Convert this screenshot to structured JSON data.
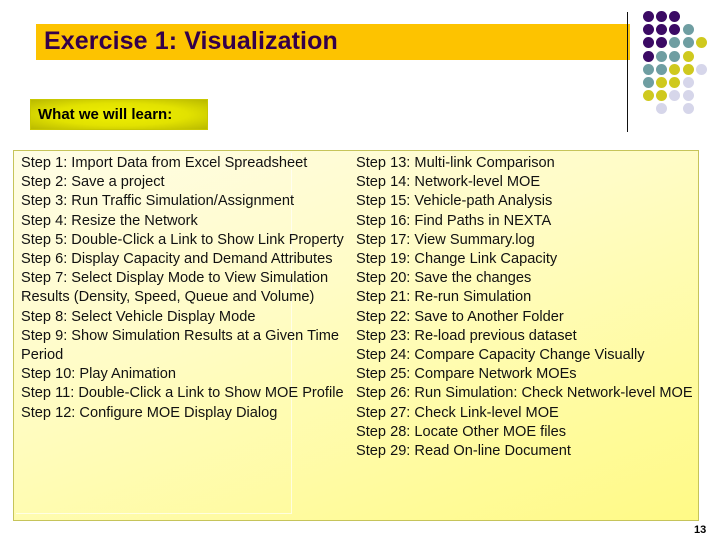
{
  "slide": {
    "title": "Exercise 1: Visualization",
    "subtitle": "What we will learn:",
    "page_number": "13",
    "colors": {
      "title_bar": "#fdc300",
      "title_text": "#33004a",
      "subtitle_bg": "#e2e200",
      "content_bg": "#fffcc6",
      "content_border": "#c6c45a"
    }
  },
  "decoration": {
    "name": "dot-grid-pattern",
    "palette": {
      "P": "#3b0a64",
      "T": "#6f9ea2",
      "Y": "#cfc91e",
      "L": "#d6d6ea"
    },
    "rows": [
      "PPP",
      "PPPT",
      "PPTTY",
      "PTTY",
      "TTYYL",
      "TYYL",
      "YYLL",
      "_L_L"
    ]
  },
  "steps_left": [
    "Step 1: Import Data from Excel Spreadsheet",
    "Step 2: Save a project",
    "Step 3: Run Traffic Simulation/Assignment",
    "Step 4: Resize the Network",
    "Step 5: Double-Click a Link to Show Link Property",
    "Step 6: Display Capacity and Demand Attributes",
    "Step 7: Select Display Mode to View Simulation Results (Density, Speed, Queue and Volume)",
    "Step 8: Select Vehicle Display Mode",
    "Step 9: Show Simulation Results at a Given Time Period",
    "Step 10: Play Animation",
    "Step 11: Double-Click a Link to Show MOE Profile",
    "Step 12: Configure MOE Display Dialog"
  ],
  "steps_right": [
    "Step 13: Multi-link Comparison",
    "Step 14: Network-level MOE",
    "Step 15: Vehicle-path Analysis",
    "Step 16: Find Paths in NEXTA",
    "Step 17: View Summary.log",
    "Step 19: Change Link Capacity",
    "Step 20: Save the changes",
    "Step 21: Re-run Simulation",
    "Step 22: Save to Another Folder",
    "Step 23: Re-load previous dataset",
    "Step 24: Compare Capacity Change Visually",
    "Step 25: Compare Network MOEs",
    "Step 26: Run Simulation: Check Network-level MOE",
    "Step 27: Check Link-level MOE",
    "Step 28: Locate Other MOE files",
    "Step 29: Read On-line Document"
  ]
}
